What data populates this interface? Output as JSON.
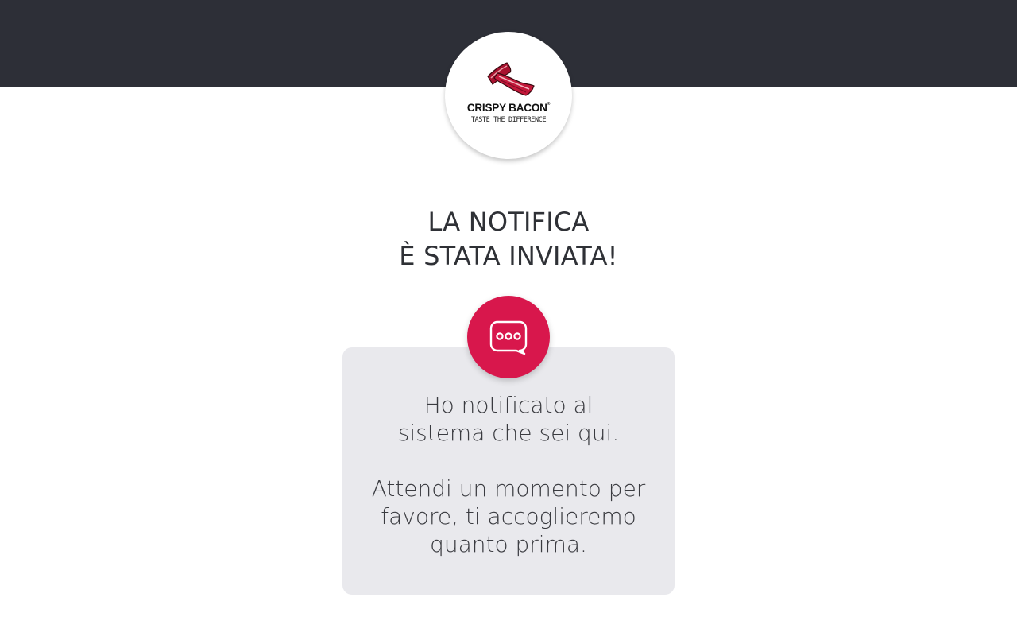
{
  "header": {
    "brand": {
      "name": "CRISPY BACON",
      "registered_mark": "®",
      "tagline": "TASTE THE DIFFERENCE",
      "logo_icon": "bacon-strips-icon"
    }
  },
  "main": {
    "headline": {
      "line1": "LA NOTIFICA",
      "line2": "È STATA INVIATA!"
    },
    "status_icon": "chat-bubble-icon",
    "message": {
      "line1": "Ho notificato al",
      "line2": "sistema che sei qui.",
      "line3": "Attendi un momento per",
      "line4": "favore, ti accoglieremo",
      "line5": "quanto prima."
    }
  },
  "colors": {
    "topbar": "#2d2f37",
    "accent": "#d8174c",
    "card": "#e9e9ed",
    "text": "#2f3136"
  }
}
